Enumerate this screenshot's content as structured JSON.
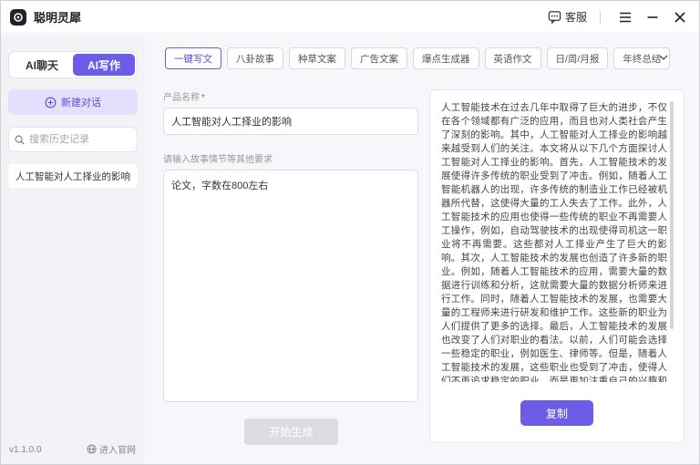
{
  "app": {
    "title": "聪明灵犀"
  },
  "titlebar": {
    "service_label": "客服"
  },
  "sidebar": {
    "mode_tabs": [
      {
        "label": "AI聊天",
        "active": false
      },
      {
        "label": "AI写作",
        "active": true
      }
    ],
    "new_chat_label": "新建对话",
    "search_placeholder": "搜索历史记录",
    "history": [
      "人工智能对人工择业的影响"
    ],
    "version": "v1.1.0.0",
    "website_label": "进入官网"
  },
  "main": {
    "tabs": [
      {
        "label": "一键写文",
        "active": true
      },
      {
        "label": "八卦故事",
        "active": false
      },
      {
        "label": "种草文案",
        "active": false
      },
      {
        "label": "广告文案",
        "active": false
      },
      {
        "label": "爆点生成器",
        "active": false
      },
      {
        "label": "英语作文",
        "active": false
      },
      {
        "label": "日/周/月报",
        "active": false
      },
      {
        "label": "年终总结",
        "active": false
      }
    ],
    "product_label": "产品名称",
    "product_required_mark": "*",
    "product_value": "人工智能对人工择业的影响",
    "requirement_label": "请输入故事情节等其他要求",
    "requirement_value": "论文，字数在800左右",
    "generate_label": "开始生成",
    "output_text": "人工智能技术在过去几年中取得了巨大的进步，不仅在各个领域都有广泛的应用，而且也对人类社会产生了深刻的影响。其中，人工智能对人工择业的影响越来越受到人们的关注。本文将从以下几个方面探讨人工智能对人工择业的影响。首先，人工智能技术的发展使得许多传统的职业受到了冲击。例如，随着人工智能机器人的出现，许多传统的制造业工作已经被机器所代替，这使得大量的工人失去了工作。此外，人工智能技术的应用也使得一些传统的职业不再需要人工操作，例如，自动驾驶技术的出现使得司机这一职业将不再需要。这些都对人工择业产生了巨大的影响。其次，人工智能技术的发展也创造了许多新的职业。例如，随着人工智能技术的应用，需要大量的数据进行训练和分析，这就需要大量的数据分析师来进行工作。同时，随着人工智能技术的发展，也需要大量的工程师来进行研发和维护工作。这些新的职业为人们提供了更多的选择。最后，人工智能技术的发展也改变了人们对职业的看法。以前，人们可能会选择一些稳定的职业，例如医生、律师等。但是，随着人工智能技术的发展，这些职业也受到了冲击，使得人们不再追求稳定的职业，而是更加注重自己的兴趣和创新能力。综上所述，人工智能技术的发展对",
    "copy_label": "复制"
  }
}
